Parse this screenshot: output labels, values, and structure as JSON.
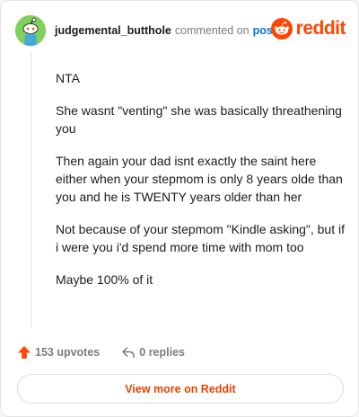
{
  "header": {
    "username": "judgemental_butthole",
    "action_text": "commented on",
    "post_link": "post",
    "logo_word": "reddit",
    "avatar_icon": "snoo-avatar-icon",
    "logo_icon": "reddit-snoo-icon"
  },
  "comment": {
    "paragraphs": [
      "NTA",
      "She wasnt \"venting\" she was basically threathening you",
      "Then again your dad isnt exactly the saint here either when your stepmom is only 8 years olde than you and he is TWENTY years older than her",
      "Not because of your stepmom \"Kindle asking\", but if i were you i'd spend more time with mom too",
      "Maybe 100% of it"
    ]
  },
  "footer": {
    "upvotes_label": "153 upvotes",
    "replies_label": "0 replies",
    "upvote_icon": "upvote-arrow-icon",
    "reply_icon": "reply-arrow-icon",
    "view_more_label": "View more on Reddit"
  },
  "colors": {
    "brand": "#ff4500",
    "avatar_bg": "#7fd05d",
    "link": "#0079d3",
    "muted": "#7c7c7c"
  }
}
